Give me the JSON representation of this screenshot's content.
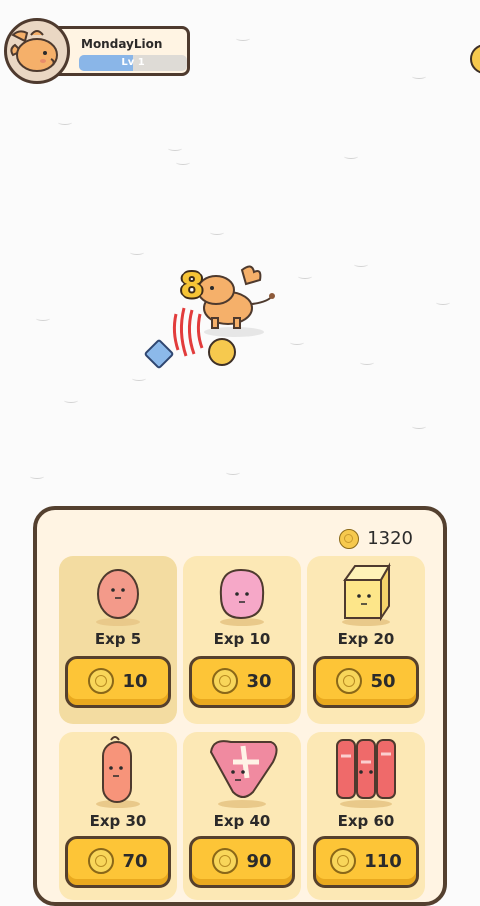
{
  "player": {
    "name": "MondayLion",
    "level_label": "Lv 1",
    "exp_progress": 0.5
  },
  "combat": {
    "damage_text": "8"
  },
  "shop": {
    "gold": "1320",
    "items": [
      {
        "exp": "Exp 5",
        "price": "10",
        "food": "ham-slice",
        "selected": true
      },
      {
        "exp": "Exp 10",
        "price": "30",
        "food": "pink-patty"
      },
      {
        "exp": "Exp 20",
        "price": "50",
        "food": "cheese"
      },
      {
        "exp": "Exp 30",
        "price": "70",
        "food": "sausage"
      },
      {
        "exp": "Exp 40",
        "price": "90",
        "food": "t-bone-steak"
      },
      {
        "exp": "Exp 60",
        "price": "110",
        "food": "bacon"
      }
    ]
  },
  "colors": {
    "panel": "#fff4e3",
    "card": "#fce8b5",
    "button": "#fdc537",
    "outline": "#54402f",
    "level_bar": "#8ab6e8"
  }
}
